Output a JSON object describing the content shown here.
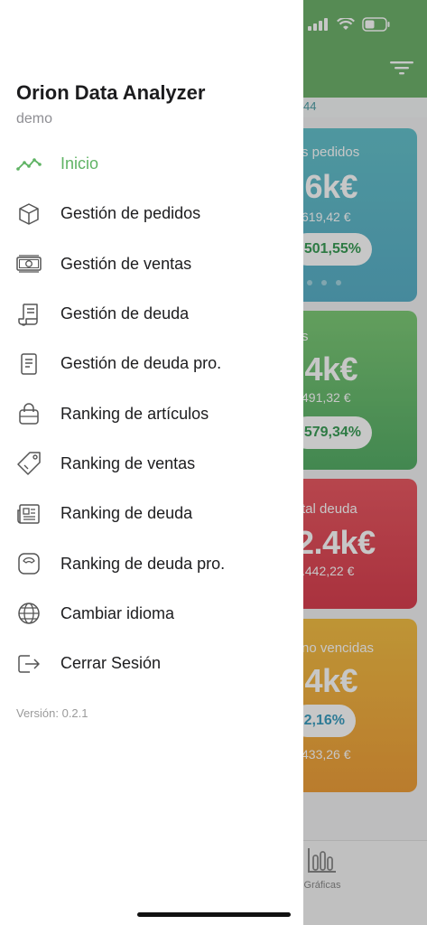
{
  "app": {
    "title": "Orion Data Analyzer",
    "user": "demo",
    "version": "Versión: 0.2.1"
  },
  "colors": {
    "accent": "#5fb364",
    "header": "#6fb26c",
    "card_blue": "#5ab0c8",
    "card_green": "#56ae67",
    "card_red": "#d94050",
    "card_orange": "#ef9f3a"
  },
  "menu": {
    "items": [
      {
        "label": "Inicio",
        "icon": "trend-line-icon",
        "active": true
      },
      {
        "label": "Gestión de pedidos",
        "icon": "box-icon",
        "active": false
      },
      {
        "label": "Gestión de ventas",
        "icon": "cash-icon",
        "active": false
      },
      {
        "label": "Gestión de deuda",
        "icon": "receipt-icon",
        "active": false
      },
      {
        "label": "Gestión de deuda pro.",
        "icon": "document-icon",
        "active": false
      },
      {
        "label": "Ranking de artículos",
        "icon": "shopping-bag-icon",
        "active": false
      },
      {
        "label": "Ranking de ventas",
        "icon": "tag-icon",
        "active": false
      },
      {
        "label": "Ranking de deuda",
        "icon": "newspaper-icon",
        "active": false
      },
      {
        "label": "Ranking de deuda pro.",
        "icon": "scale-icon",
        "active": false
      },
      {
        "label": "Cambiar idioma",
        "icon": "globe-icon",
        "active": false
      },
      {
        "label": "Cerrar Sesión",
        "icon": "logout-icon",
        "active": false
      }
    ]
  },
  "background": {
    "strip_text": "44",
    "cards": [
      {
        "title": "s pedidos",
        "big": ".6k€",
        "sub": "619,42 €",
        "pill": "501,55%",
        "pill_color": "#3a9d57"
      },
      {
        "title": "s",
        "big": ".4k€",
        "sub": "491,32 €",
        "pill": "579,34%",
        "pill_color": "#3a9d57"
      },
      {
        "title": "tal deuda",
        "big": "2.4k€",
        "sub": ".442,22 €",
        "pill": "",
        "pill_color": ""
      },
      {
        "title": "no vencidas",
        "big": ".4k€",
        "sub": "433,26 €",
        "pill": "2,16%",
        "pill_color": "#3a9dbf"
      }
    ],
    "tab_charts_label": "Gráficas"
  }
}
